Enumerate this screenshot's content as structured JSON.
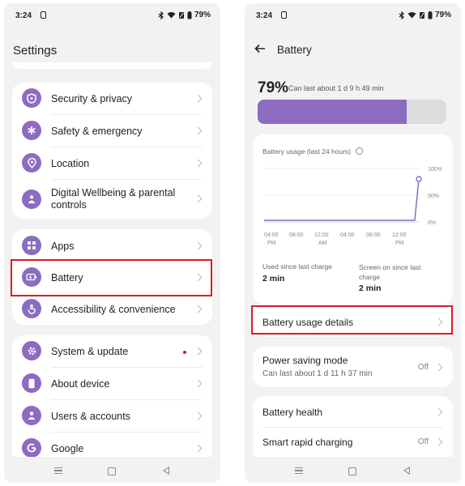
{
  "status": {
    "time": "3:24",
    "battery": "79%"
  },
  "settings": {
    "title": "Settings",
    "group1": [
      {
        "label": "Security & privacy",
        "icon": "shield-icon"
      },
      {
        "label": "Safety & emergency",
        "icon": "asterisk-icon"
      },
      {
        "label": "Location",
        "icon": "location-pin-icon"
      },
      {
        "label": "Digital Wellbeing & parental controls",
        "icon": "wellbeing-icon"
      }
    ],
    "group2": [
      {
        "label": "Apps",
        "icon": "apps-grid-icon"
      },
      {
        "label": "Battery",
        "icon": "battery-icon"
      },
      {
        "label": "Accessibility & convenience",
        "icon": "accessibility-hand-icon"
      }
    ],
    "group3": [
      {
        "label": "System & update",
        "icon": "gear-icon"
      },
      {
        "label": "About device",
        "icon": "phone-device-icon"
      },
      {
        "label": "Users & accounts",
        "icon": "user-icon"
      },
      {
        "label": "Google",
        "icon": "google-icon"
      }
    ]
  },
  "battery": {
    "title": "Battery",
    "percent": "79%",
    "percent_value": 79,
    "estimate": "Can last about 1 d 9 h 49 min",
    "chart_title": "Battery usage (last 24 hours)",
    "y_ticks": [
      "100%",
      "50%",
      "0%"
    ],
    "x_ticks": [
      {
        "top": "04:00",
        "bottom": "PM"
      },
      {
        "top": "08:00",
        "bottom": ""
      },
      {
        "top": "12:00",
        "bottom": "AM"
      },
      {
        "top": "04:00",
        "bottom": ""
      },
      {
        "top": "08:00",
        "bottom": ""
      },
      {
        "top": "12:00",
        "bottom": "PM"
      }
    ],
    "used_label": "Used since last charge",
    "used_value": "2 min",
    "screen_label": "Screen on since last charge",
    "screen_value": "2 min",
    "usage_details": "Battery usage details",
    "power_saving": {
      "title": "Power saving mode",
      "subtitle": "Can last about 1 d 11 h 37 min",
      "value": "Off"
    },
    "health": "Battery health",
    "rapid": {
      "title": "Smart rapid charging",
      "value": "Off"
    }
  },
  "colors": {
    "accent": "#8b6cc1",
    "highlight": "#d61f26",
    "track": "#dcdcdc"
  }
}
